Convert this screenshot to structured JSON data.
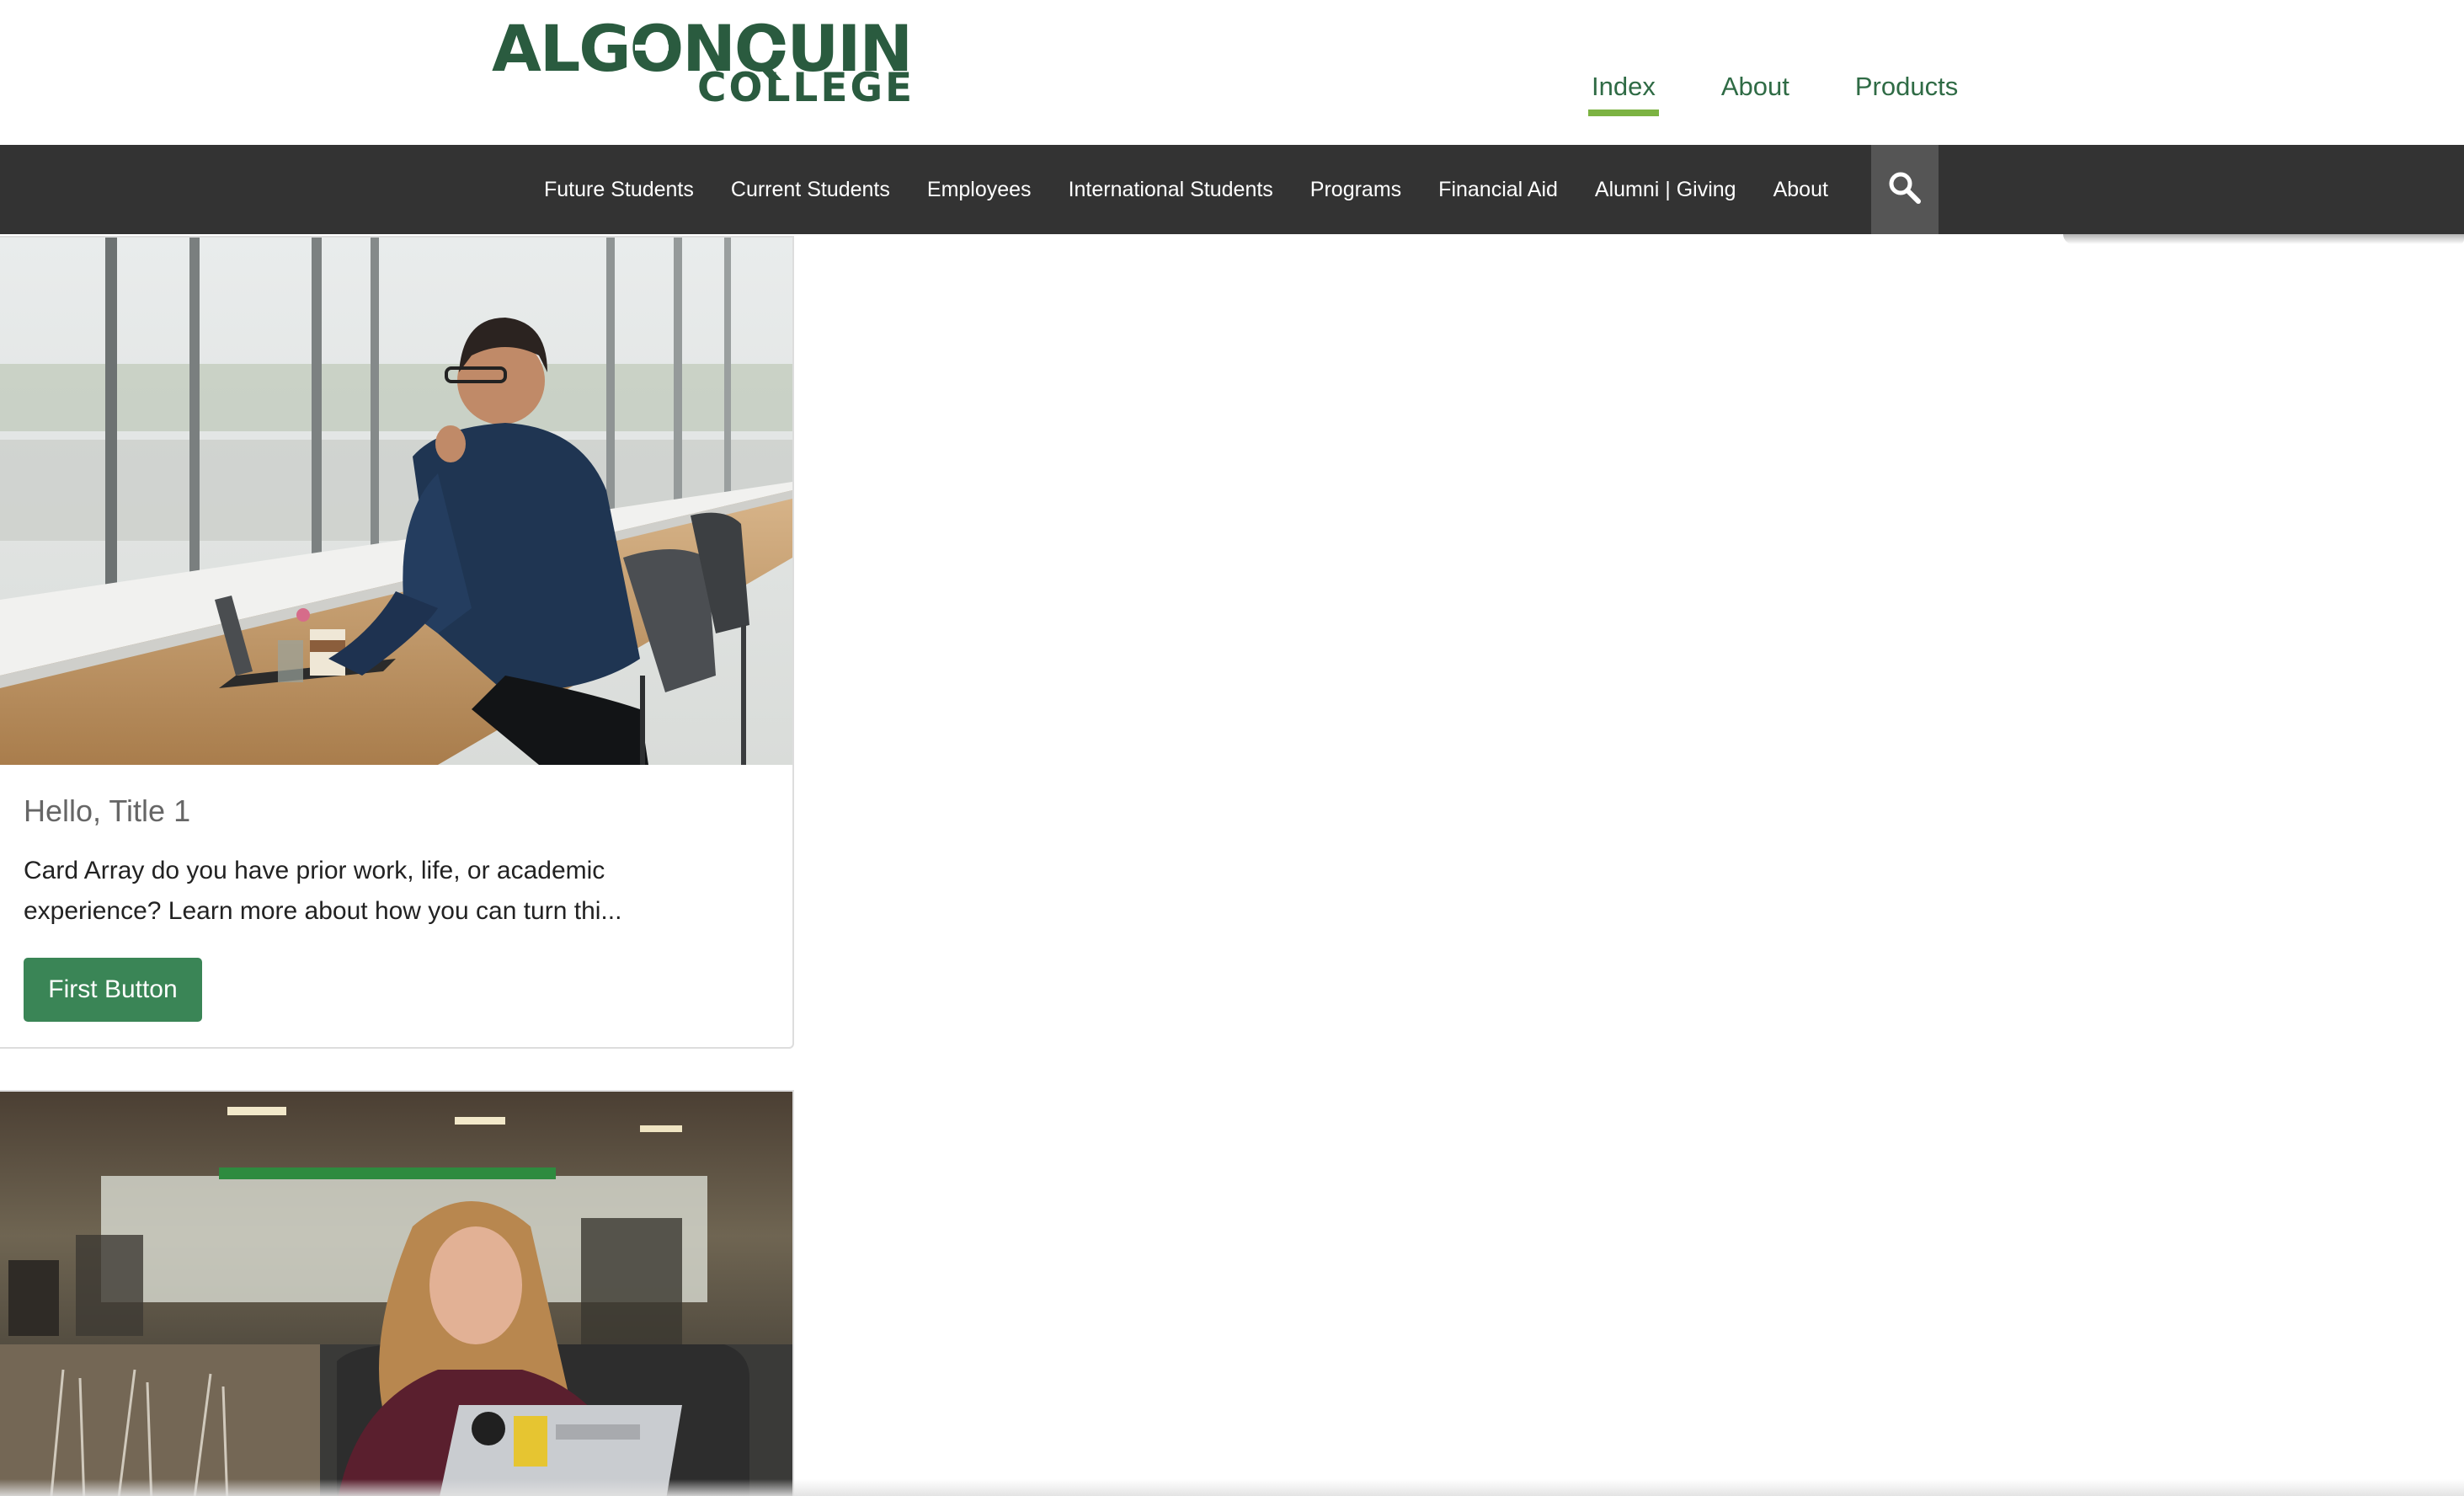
{
  "brand": {
    "name_top": "ALGONQUIN",
    "name_bottom": "COLLEGE",
    "color": "#2a5b3f"
  },
  "top_nav": {
    "items": [
      {
        "label": "Index",
        "active": true
      },
      {
        "label": "About",
        "active": false
      },
      {
        "label": "Products",
        "active": false
      }
    ],
    "active_underline_color": "#7cb342"
  },
  "main_nav": {
    "background": "#333333",
    "items": [
      {
        "label": "Future Students"
      },
      {
        "label": "Current Students"
      },
      {
        "label": "Employees"
      },
      {
        "label": "International Students"
      },
      {
        "label": "Programs"
      },
      {
        "label": "Financial Aid"
      },
      {
        "label": "Alumni | Giving"
      },
      {
        "label": "About"
      }
    ],
    "search_icon": "search-icon"
  },
  "cards": [
    {
      "image": "student-with-laptop-photo",
      "title": "Hello, Title 1",
      "text": "Card Array do you have prior work, life, or academic experience? Learn more about how you can turn thi...",
      "button_label": "First Button",
      "button_color": "#3a8556"
    },
    {
      "image": "student-in-cafeteria-photo"
    }
  ]
}
